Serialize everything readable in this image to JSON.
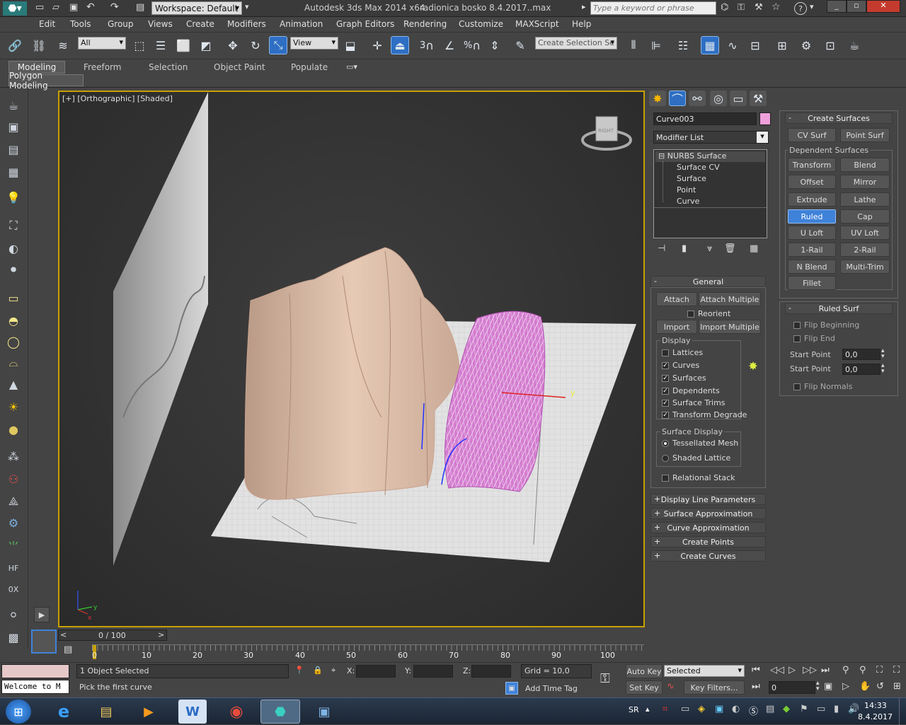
{
  "title": {
    "workspace": "Workspace: Default",
    "app": "Autodesk 3ds Max  2014 x64",
    "file": "radionica bosko 8.4.2017..max",
    "search_placeholder": "Type a keyword or phrase"
  },
  "menu": [
    "Edit",
    "Tools",
    "Group",
    "Views",
    "Create",
    "Modifiers",
    "Animation",
    "Graph Editors",
    "Rendering",
    "Customize",
    "MAXScript",
    "Help"
  ],
  "toolbar": {
    "filter": "All",
    "refcoord": "View",
    "selset_placeholder": "Create Selection Se",
    "snap_labels": [
      "3",
      "%"
    ]
  },
  "ribbon": {
    "tabs": [
      "Modeling",
      "Freeform",
      "Selection",
      "Object Paint",
      "Populate"
    ],
    "subtab": "Polygon Modeling"
  },
  "viewport": {
    "label_plus": "[+]",
    "label_view": "[Orthographic]",
    "label_shade": "[Shaded]",
    "axis_y": "y",
    "gizmo_y": "y",
    "gizmo_x": "x",
    "viewcube_label": "RIGHT"
  },
  "command_panel": {
    "object_name": "Curve003",
    "object_color": "#f0a0dc",
    "modifier_list": "Modifier List",
    "stack": [
      "NURBS Surface",
      "Surface CV",
      "Surface",
      "Point",
      "Curve"
    ],
    "general": {
      "title": "General",
      "attach": "Attach",
      "attach_multiple": "Attach Multiple",
      "reorient": "Reorient",
      "import": "Import",
      "import_multiple": "Import Multiple",
      "display_title": "Display",
      "display": [
        {
          "label": "Lattices",
          "checked": false
        },
        {
          "label": "Curves",
          "checked": true
        },
        {
          "label": "Surfaces",
          "checked": true
        },
        {
          "label": "Dependents",
          "checked": true
        },
        {
          "label": "Surface Trims",
          "checked": true
        },
        {
          "label": "Transform Degrade",
          "checked": true
        }
      ],
      "surface_display_title": "Surface Display",
      "tessellated": "Tessellated Mesh",
      "shaded_lattice": "Shaded Lattice",
      "relational": "Relational Stack"
    },
    "rollouts": [
      "Display Line Parameters",
      "Surface Approximation",
      "Curve Approximation",
      "Create Points",
      "Create Curves"
    ],
    "create_surfaces": {
      "title": "Create Surfaces",
      "cv_surf": "CV Surf",
      "point_surf": "Point Surf",
      "dependent_title": "Dependent Surfaces",
      "buttons": [
        "Transform",
        "Blend",
        "Offset",
        "Mirror",
        "Extrude",
        "Lathe",
        "Ruled",
        "Cap",
        "U Loft",
        "UV Loft",
        "1-Rail",
        "2-Rail",
        "N Blend",
        "Multi-Trim",
        "Fillet"
      ],
      "active": "Ruled"
    },
    "ruled_surf": {
      "title": "Ruled Surf",
      "flip_beginning": "Flip Beginning",
      "flip_end": "Flip End",
      "start_point_label": "Start Point",
      "start_point_1": "0,0",
      "start_point_2": "0,0",
      "flip_normals": "Flip Normals"
    }
  },
  "timeline": {
    "frame": "0 / 100",
    "ticks": [
      "0",
      "10",
      "20",
      "30",
      "40",
      "50",
      "60",
      "70",
      "80",
      "90",
      "100"
    ],
    "prev": "<",
    "next": ">"
  },
  "status": {
    "listener": "Welcome to M",
    "selected": "1 Object Selected",
    "prompt": "Pick the first curve",
    "x_label": "X:",
    "y_label": "Y:",
    "z_label": "Z:",
    "grid": "Grid = 10,0",
    "add_time_tag": "Add Time Tag",
    "auto_key": "Auto Key",
    "set_key": "Set Key",
    "selected_dropdown": "Selected",
    "key_filters": "Key Filters...",
    "frame_field": "0"
  },
  "taskbar": {
    "lang": "SR",
    "time": "14:33",
    "date": "8.4.2017"
  }
}
